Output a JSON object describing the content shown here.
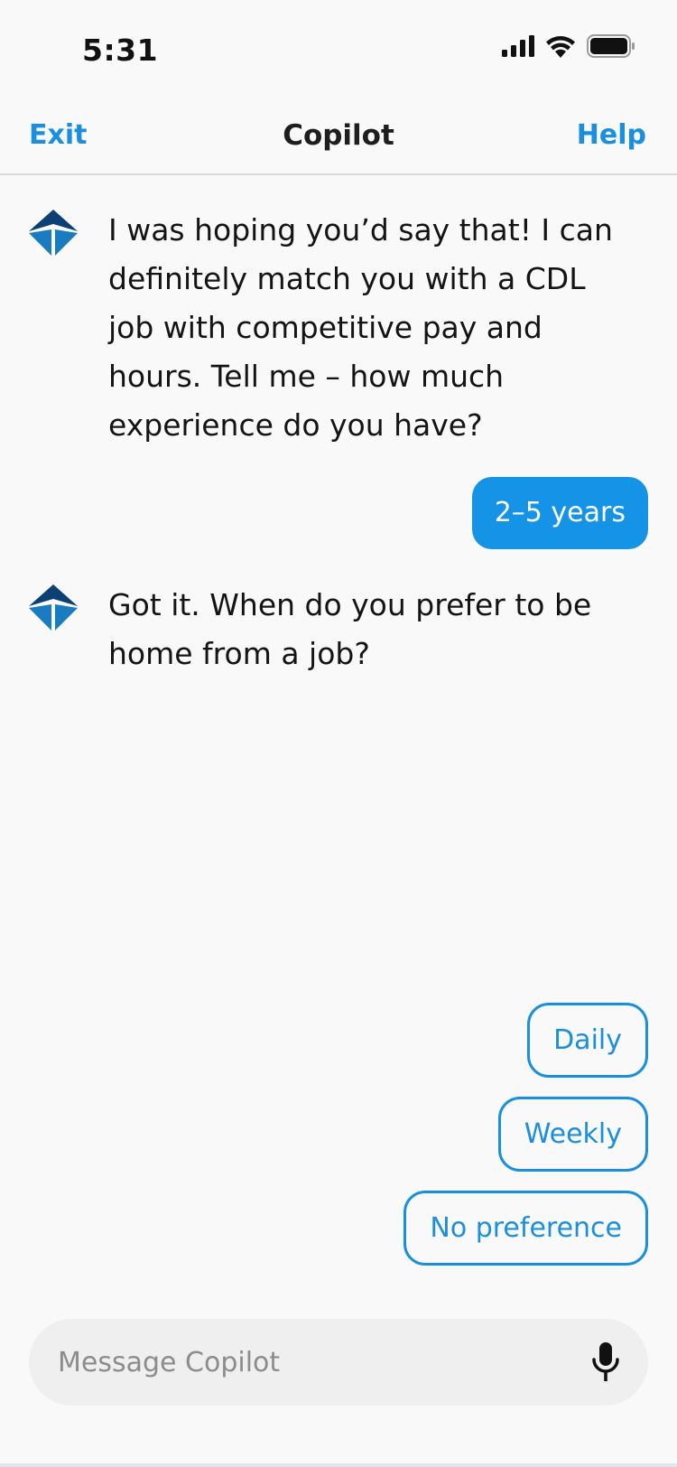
{
  "status_bar": {
    "time": "5:31",
    "icons": [
      "cellular-signal-icon",
      "wifi-icon",
      "battery-icon"
    ]
  },
  "nav": {
    "exit_label": "Exit",
    "title": "Copilot",
    "help_label": "Help"
  },
  "messages": [
    {
      "sender": "bot",
      "avatar_icon": "copilot-logo-icon",
      "text": "I was hoping you’d say that! I can definitely match you with a CDL job with competitive pay and hours. Tell me – how much experience do you have?"
    },
    {
      "sender": "user",
      "text": "2–5 years"
    },
    {
      "sender": "bot",
      "avatar_icon": "copilot-logo-icon",
      "text": "Got it. When do you prefer to be home from a job?"
    }
  ],
  "quick_replies": [
    "Daily",
    "Weekly",
    "No preference"
  ],
  "composer": {
    "placeholder": "Message Copilot",
    "mic_icon": "microphone-icon"
  },
  "colors": {
    "accent": "#1a8fe0",
    "user_bubble": "#1593e6",
    "logo_dark": "#0c3f73",
    "logo_light": "#1a7cc0",
    "background": "#f9f9fa",
    "composer_bg": "#efefef"
  }
}
